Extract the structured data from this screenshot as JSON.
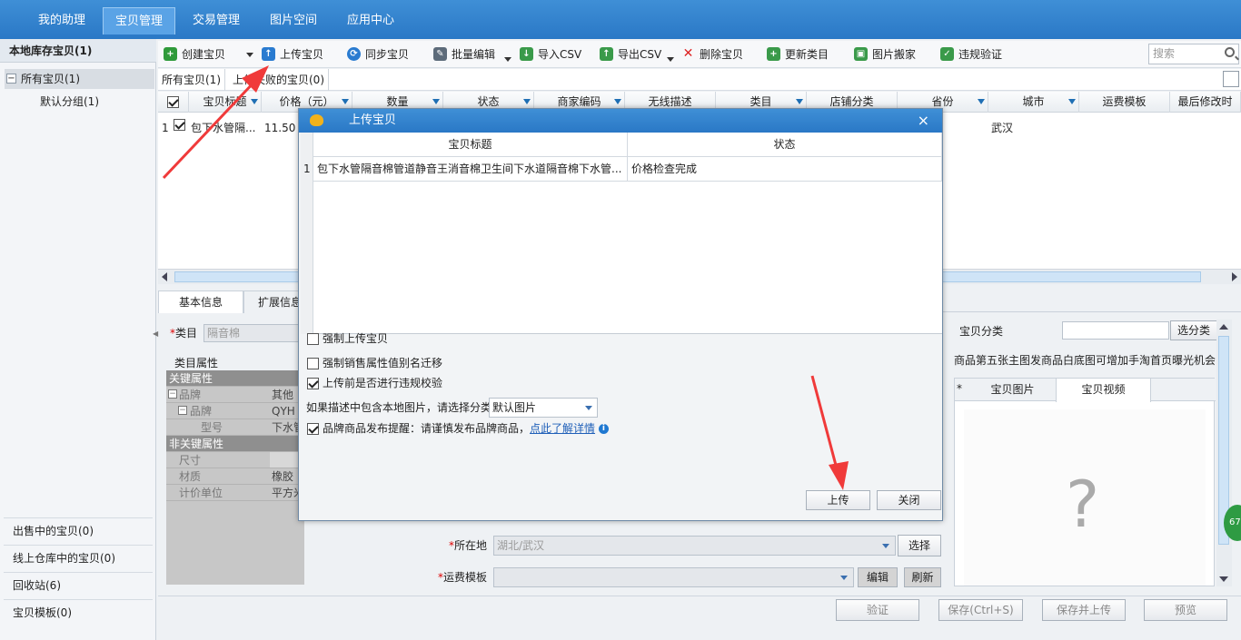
{
  "nav": {
    "tabs": [
      "我的助理",
      "宝贝管理",
      "交易管理",
      "图片空间",
      "应用中心"
    ],
    "active": 1
  },
  "left": {
    "title": "本地库存宝贝(1)",
    "all_items": "所有宝贝(1)",
    "default_group": "默认分组(1)",
    "bottom": [
      "出售中的宝贝(0)",
      "线上仓库中的宝贝(0)",
      "回收站(6)",
      "宝贝模板(0)"
    ]
  },
  "toolbar": {
    "create": "创建宝贝",
    "upload": "上传宝贝",
    "sync": "同步宝贝",
    "batch_edit": "批量编辑",
    "import_csv": "导入CSV",
    "export_csv": "导出CSV",
    "delete": "删除宝贝",
    "update_category": "更新类目",
    "picture_move": "图片搬家",
    "violation_check": "违规验证",
    "search_placeholder": "搜索"
  },
  "subtabs": [
    "所有宝贝(1)",
    "上传失败的宝贝(0)"
  ],
  "grid": {
    "columns": [
      "宝贝标题",
      "价格（元）",
      "数量",
      "状态",
      "商家编码",
      "无线描述",
      "类目",
      "店铺分类",
      "省份",
      "城市",
      "运费模板",
      "最后修改时"
    ],
    "row": {
      "index": "1",
      "title": "包下水管隔...",
      "price": "11.50",
      "city": "武汉"
    }
  },
  "detail": {
    "tabs": [
      "基本信息",
      "扩展信息"
    ],
    "category_label": "类目",
    "category_value": "隔音棉",
    "attr_group_label": "类目属性",
    "attrs": [
      {
        "label": "关键属性",
        "head": true,
        "value": ""
      },
      {
        "label": "品牌",
        "head": false,
        "value": "其他"
      },
      {
        "label": "品牌",
        "head": false,
        "value": "QYH"
      },
      {
        "label": "型号",
        "head": false,
        "value": "下水管"
      },
      {
        "label": "非关键属性",
        "head": true,
        "value": ""
      },
      {
        "label": "尺寸",
        "head": false,
        "value": ""
      },
      {
        "label": "材质",
        "head": false,
        "value": "橡胶"
      },
      {
        "label": "计价单位",
        "head": false,
        "value": "平方米"
      }
    ],
    "location_label": "所在地",
    "location_value": "湖北/武汉",
    "location_btn": "选择",
    "freight_label": "运费模板",
    "freight_value": "",
    "edit_btn": "编辑",
    "refresh_btn": "刷新",
    "item_category_label": "宝贝分类",
    "select_category_btn": "选分类",
    "promo_text": "商品第五张主图发商品白底图可增加手淘首页曝光机会",
    "media_tabs": [
      "宝贝图片",
      "宝贝视频"
    ],
    "media_star": "*",
    "unknown_image": "?",
    "badge": "67"
  },
  "bottom_buttons": [
    "验证",
    "保存(Ctrl+S)",
    "保存并上传",
    "预览"
  ],
  "modal": {
    "title": "上传宝贝",
    "close": "×",
    "columns": [
      "宝贝标题",
      "状态"
    ],
    "row": {
      "index": "1",
      "title": "包下水管隔音棉管道静音王消音棉卫生间下水道隔音棉下水管...",
      "status": "价格检查完成"
    },
    "options": [
      {
        "label": "强制上传宝贝",
        "checked": false
      },
      {
        "label": "强制销售属性值别名迁移",
        "checked": false
      },
      {
        "label": "上传前是否进行违规校验",
        "checked": true
      }
    ],
    "image_cat_label": "如果描述中包含本地图片，请选择分类",
    "image_cat_value": "默认图片",
    "brand_label": "品牌商品发布提醒：请谨慎发布品牌商品，",
    "brand_link": "点此了解详情",
    "brand_checked": true,
    "upload_btn": "上传",
    "close_btn": "关闭"
  }
}
